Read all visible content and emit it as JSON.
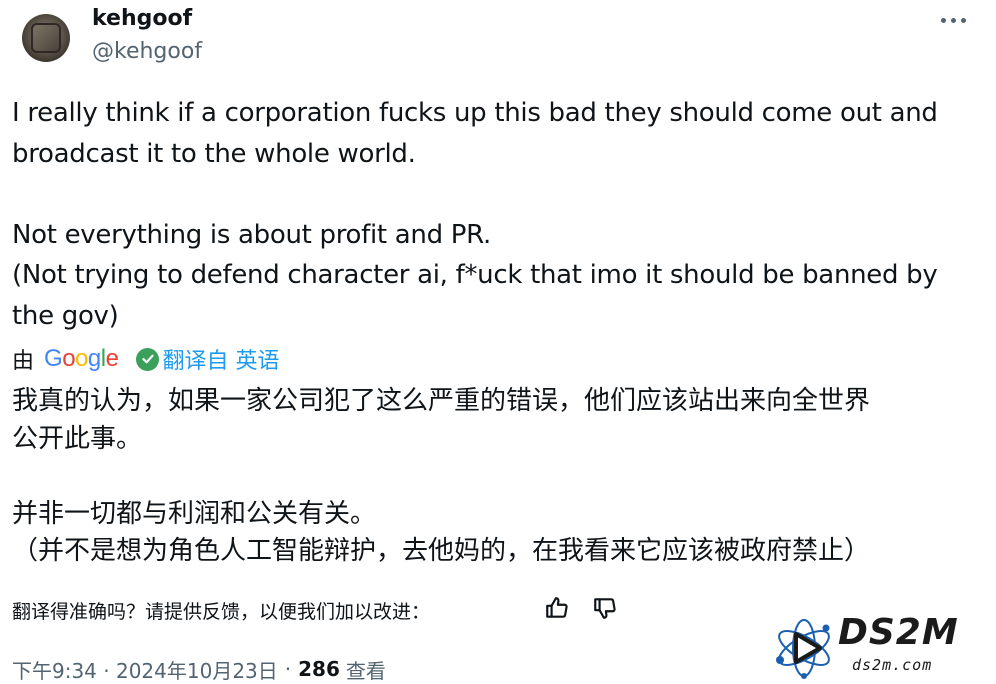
{
  "author": {
    "display_name": "kehgoof",
    "handle": "@kehgoof"
  },
  "tweet": {
    "text": "I really think if a corporation fucks up this bad they should come out and\nbroadcast it to the whole world.\n\nNot everything is about profit and PR.\n(Not trying to defend character ai, f*uck that imo it should be banned by\nthe gov)"
  },
  "translation": {
    "by_label": "由",
    "provider": "Google",
    "translated_from_label": "翻译自 英语",
    "text": "我真的认为，如果一家公司犯了这么严重的错误，他们应该站出来向全世界\n公开此事。\n\n并非一切都与利润和公关有关。\n（并不是想为角色人工智能辩护，去他妈的，在我看来它应该被政府禁止）",
    "feedback_prompt": "翻译得准确吗？请提供反馈，以便我们加以改进："
  },
  "meta": {
    "time": "下午9:34 · 2024年10月23日",
    "separator": "·",
    "views_count": "286",
    "views_label": "查看"
  },
  "watermark": {
    "text": "DS2M",
    "sub": "ds2m.com"
  },
  "colors": {
    "accent": "#1d9bf0",
    "secondary_text": "#536471",
    "check_green": "#3aa05b"
  },
  "icons": {
    "more": "more-horizontal-icon",
    "verified_check": "check-circle-icon",
    "thumb_up": "thumbs-up-icon",
    "thumb_down": "thumbs-down-icon"
  }
}
